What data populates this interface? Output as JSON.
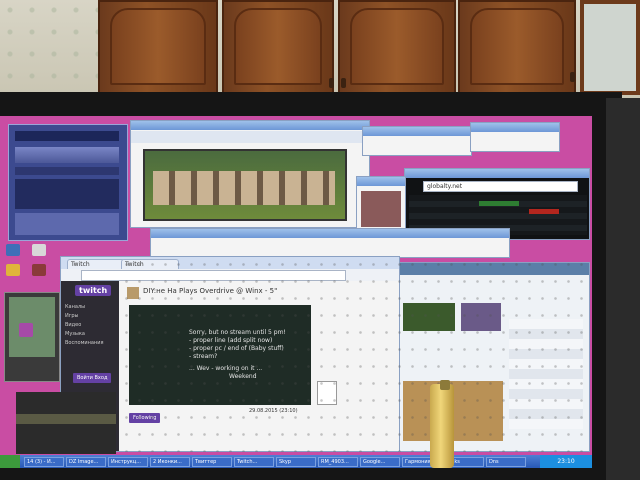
{
  "browser_front": {
    "tabs": [
      "Twitch",
      "Twitch"
    ],
    "video": {
      "title": "DIY:не На Plays Overdrive @ Winx - 5\"",
      "lines": [
        "Sorry, but no stream until 5 pm!",
        "- proper line (add split now)",
        "- proper pc / end of (Baby stuff)",
        "- stream?",
        "... Wev - working on it ...",
        "Weekend"
      ],
      "timestamp": "29.08.2015 (23:10)"
    },
    "sidebar": {
      "logo": "twitch",
      "links": [
        "Каналы",
        "Игры",
        "Видео",
        "Музыка",
        "Воспоминания"
      ],
      "button": "Войти Вход"
    },
    "follow_label": "Following"
  },
  "taskbar": {
    "tasks": [
      "",
      "14 (3) - И...",
      "DZ Image...",
      "Инструкц...",
      "2 Иконки...",
      "Твиттер",
      "Twitch...",
      "Skyp",
      "RM_4903...",
      "Google...",
      "Гармония",
      "Links",
      "Dns"
    ],
    "clock": "23:10"
  },
  "misc": {
    "media_player_title": "",
    "background_browser_url": "",
    "ticker_window_url": "globalty.net"
  },
  "colors": {
    "desktop": "#c94da3",
    "twitch_purple": "#6441a4",
    "taskbar": "#2758b5",
    "bezel": "#151515"
  }
}
